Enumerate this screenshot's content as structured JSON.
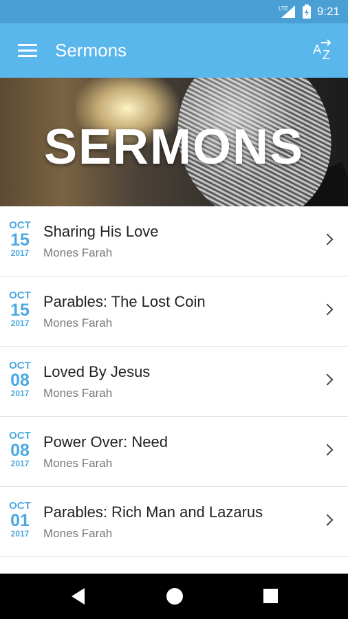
{
  "status_bar": {
    "network": "LTE",
    "time": "9:21"
  },
  "app_bar": {
    "title": "Sermons"
  },
  "hero": {
    "text": "SERMONS"
  },
  "sermons": [
    {
      "month": "OCT",
      "day": "15",
      "year": "2017",
      "title": "Sharing His Love",
      "speaker": "Mones Farah"
    },
    {
      "month": "OCT",
      "day": "15",
      "year": "2017",
      "title": "Parables: The Lost Coin",
      "speaker": "Mones Farah"
    },
    {
      "month": "OCT",
      "day": "08",
      "year": "2017",
      "title": "Loved By Jesus",
      "speaker": "Mones Farah"
    },
    {
      "month": "OCT",
      "day": "08",
      "year": "2017",
      "title": "Power Over: Need",
      "speaker": "Mones Farah"
    },
    {
      "month": "OCT",
      "day": "01",
      "year": "2017",
      "title": "Parables: Rich Man and Lazarus",
      "speaker": "Mones Farah"
    }
  ],
  "icons": {
    "menu": "hamburger-menu-icon",
    "sort": "sort-a-z-icon",
    "chevron": "chevron-right-icon",
    "back": "back-triangle-icon",
    "home": "home-circle-icon",
    "recents": "recents-square-icon"
  },
  "colors": {
    "status_bar": "#4a9fd5",
    "app_bar": "#5ab7ec",
    "date_accent": "#4aa9e2"
  }
}
